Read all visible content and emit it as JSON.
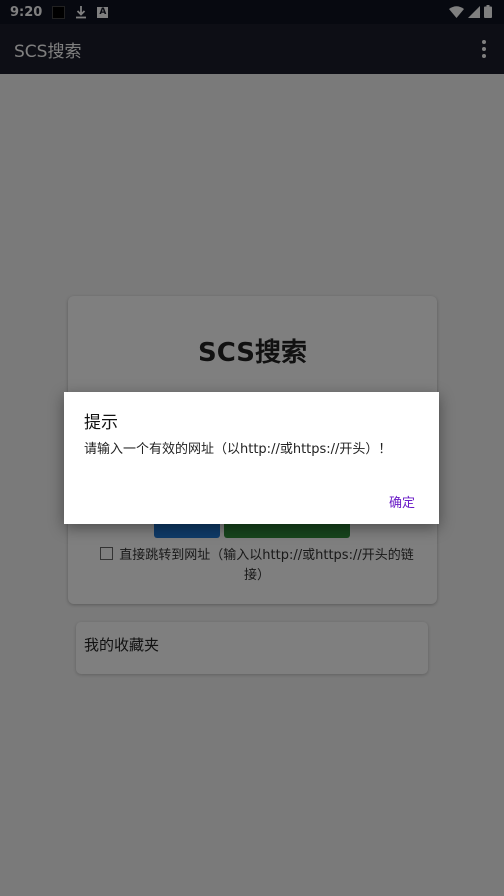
{
  "status_bar": {
    "time": "9:20",
    "icons": [
      "notification-square-icon",
      "download-icon",
      "app-a-icon",
      "wifi-icon",
      "signal-icon",
      "battery-icon"
    ]
  },
  "app_bar": {
    "title": "SCS搜索",
    "menu_icon": "more-vert-icon"
  },
  "main_card": {
    "title": "SCS搜索",
    "checkbox_label": "直接跳转到网址（输入以http://或https://开头的链接）",
    "checkbox_checked": false
  },
  "favorites": {
    "label": "我的收藏夹"
  },
  "dialog": {
    "title": "提示",
    "message": "请输入一个有效的网址（以http://或https://开头）！",
    "ok_label": "确定"
  },
  "colors": {
    "app_bar": "#1b1d2b",
    "status_bar": "#0f1220",
    "accent": "#6a1bc7",
    "search_button": "#1e76d2",
    "favorite_button": "#2e8b3a"
  }
}
